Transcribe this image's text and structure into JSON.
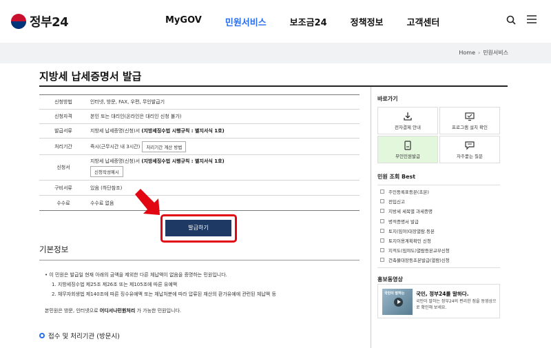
{
  "header": {
    "logo_text": "정부24",
    "nav": [
      "MyGOV",
      "민원서비스",
      "보조금24",
      "정책정보",
      "고객센터"
    ],
    "active_nav": "민원서비스"
  },
  "breadcrumb": {
    "home": "Home",
    "current": "민원서비스"
  },
  "page_title": "지방세 납세증명서 발급",
  "info_rows": [
    {
      "label": "신청방법",
      "value": "인터넷, 방문, FAX, 우편, 무인발급기"
    },
    {
      "label": "신청자격",
      "value": "본인 또는 대리인(온라인은 대리인 신청 불가)"
    },
    {
      "label": "발급서류",
      "value_prefix": "지방세 납세증명(신청)서 ",
      "value_bold": "(지방세징수법 시행규칙 : 별지서식 1호)"
    },
    {
      "label": "처리기간",
      "value": "즉시(근무시간 내 3시간)",
      "button": "처리기간 계산 방법"
    },
    {
      "label": "신청서",
      "value_prefix": "지방세 납세증명(신청)서 ",
      "value_bold": "(지방세징수법 시행규칙 : 별지서식 1호)",
      "button": "신청작성예시"
    },
    {
      "label": "구비서류",
      "value": "있음 (하단참조)"
    },
    {
      "label": "수수료",
      "value": "수수료 없음"
    }
  ],
  "issue_button": "발급하기",
  "basic_info": {
    "title": "기본정보",
    "line1": "• 이 민원은 발급일 현재 아래의 금액을 제외한 다른 체납액이 없음을 증명하는 민원입니다.",
    "line2": "1. 지방세징수법 제25조 제26조 또는 제105조에 따른 유예액",
    "line3": "2. 채무자회생법 제140조에 따른 징수유예액 또는 체납처분에 따라 압류된 재산의 환가유예에 관련된 체납액 등",
    "note_prefix": "본민원은 방문, 인터넷으로 ",
    "note_bold": "어디서나민원처리",
    "note_suffix": " 가 가능한 민원입니다."
  },
  "process_title": "접수 및 처리기관 (방문시)",
  "sidebar": {
    "quick_title": "바로가기",
    "quick_items": [
      {
        "label": "전자결제 안내",
        "icon": "download-icon"
      },
      {
        "label": "프로그램 설치 확인",
        "icon": "monitor-icon"
      },
      {
        "label": "무인민원발급",
        "icon": "kiosk-icon"
      },
      {
        "label": "자주묻는 질문",
        "icon": "chat-icon"
      }
    ],
    "best_title": "민원 조회 Best",
    "best_items": [
      "주민등록표등본(초본)",
      "전입신고",
      "지방세 세목별 과세증명",
      "병적증명서 발급",
      "토지(임야)대장열람.등본",
      "토지이용계획확인 신청",
      "지적도(임야도)열람등본교부신청",
      "건축물대장등초본발급(열람)신청"
    ],
    "video_title_label": "홍보동영상",
    "video_title": "국민, 정부24를 말하다.",
    "video_desc": "국민이 말하는 정부24의 편리한 점을 동영상으로 확인해 보세요.",
    "video_thumb_text": "국민이 말하는"
  },
  "colors": {
    "accent_blue": "#256ef4",
    "issue_button": "#1e3a64",
    "highlight_red": "#e20512",
    "quick_highlight": "#e2f7dc"
  }
}
